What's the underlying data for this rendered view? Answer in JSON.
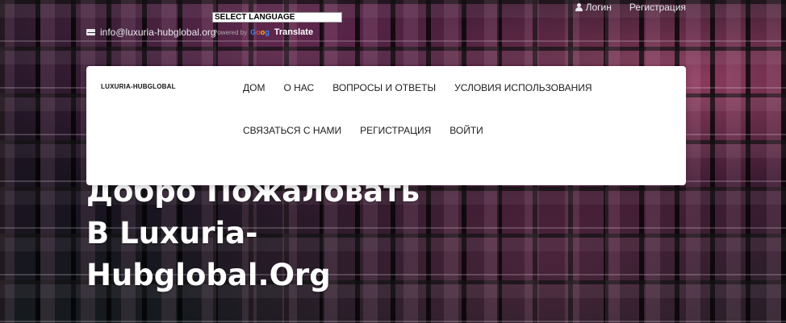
{
  "header": {
    "email": "info@luxuria-hubglobal.org",
    "language_select": "SELECT LANGUAGE",
    "powered_by": "Powered by",
    "google_logo": "Google",
    "translate": "Translate",
    "login": "Логин",
    "register": "Регистрация"
  },
  "nav": {
    "logo": "LUXURIA-HUBGLOBAL",
    "items": [
      "ДОМ",
      "О НАС",
      "ВОПРОСЫ И ОТВЕТЫ",
      "УСЛОВИЯ ИСПОЛЬЗОВАНИЯ",
      "СВЯЗАТЬСЯ С НАМИ",
      "РЕГИСТРАЦИЯ",
      "ВОЙТИ"
    ]
  },
  "hero": {
    "line1": "Добро Пожаловать",
    "line2": "В Luxuria-",
    "line3": "Hubglobal.Org"
  },
  "colors": {
    "nav_background": "#ffffff",
    "accent": "#d6508f",
    "text_light": "#e8e8ee"
  },
  "icons": {
    "email": "envelope-icon",
    "login": "user-icon",
    "translate": "google-icon"
  }
}
